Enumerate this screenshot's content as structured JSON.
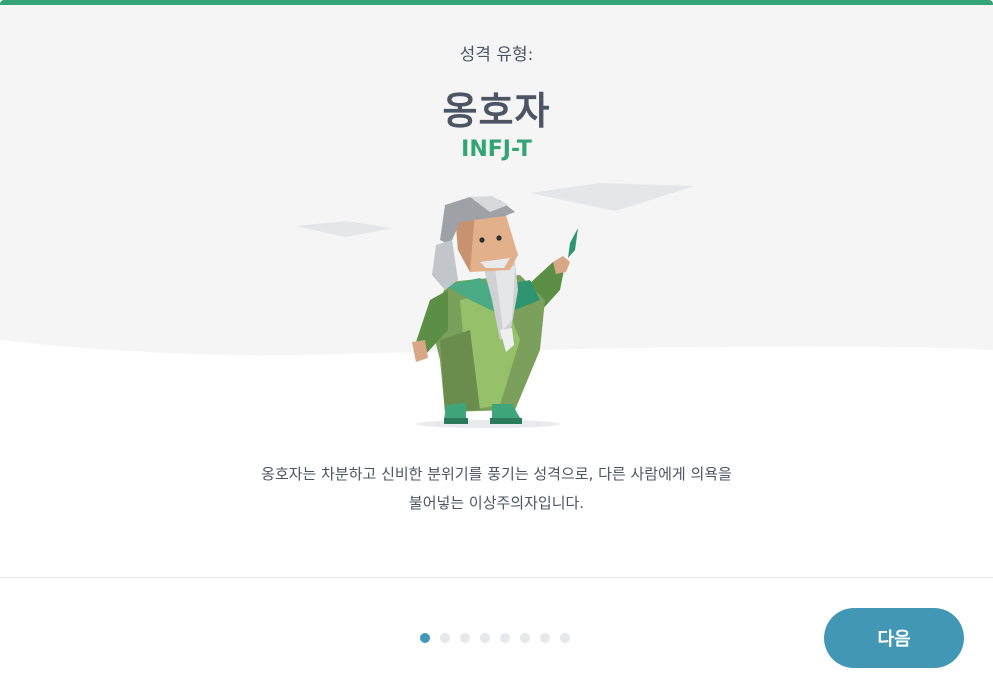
{
  "header": {
    "subtitle": "성격 유형:",
    "type_name": "옹호자",
    "type_code": "INFJ-T"
  },
  "description": {
    "line1": "옹호자는 차분하고 신비한 분위기를 풍기는 성격으로, 다른 사람에게 의욕을",
    "line2": "불어넣는 이상주의자입니다."
  },
  "pager": {
    "total": 8,
    "active_index": 0
  },
  "actions": {
    "next_label": "다음"
  },
  "colors": {
    "accent_green": "#33a474",
    "button_blue": "#4298b4",
    "text_dark": "#4d5565",
    "hero_bg": "#f5f5f6"
  },
  "illustration": {
    "icon": "advocate-sage-character"
  }
}
